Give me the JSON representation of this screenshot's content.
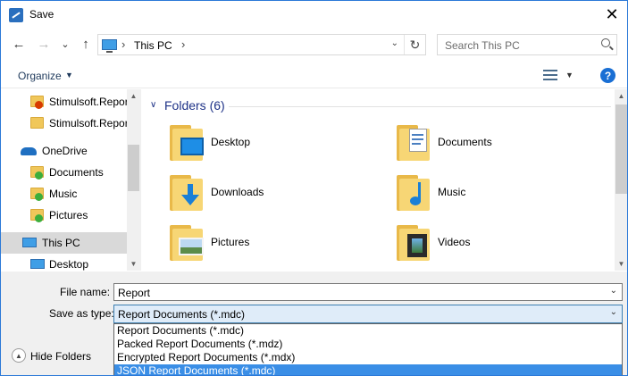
{
  "window": {
    "title": "Save",
    "close_glyph": "✕"
  },
  "nav": {
    "back_glyph": "←",
    "forward_glyph": "→",
    "recent_glyph": "⌄",
    "up_glyph": "↑",
    "address_separator": "›",
    "address_text": "This PC",
    "address_dropdown_glyph": "⌄",
    "refresh_glyph": "↻",
    "search_placeholder": "Search This PC"
  },
  "toolbar": {
    "organize_label": "Organize",
    "caret_glyph": "▼",
    "help_label": "?"
  },
  "sidebar": {
    "items": [
      {
        "label": "Stimulsoft.Repor",
        "icon": "folder-warning-icon"
      },
      {
        "label": "Stimulsoft.Repor",
        "icon": "folder-icon"
      },
      {
        "label": "OneDrive",
        "icon": "cloud-icon"
      },
      {
        "label": "Documents",
        "icon": "folder-synced-icon"
      },
      {
        "label": "Music",
        "icon": "folder-synced-icon"
      },
      {
        "label": "Pictures",
        "icon": "folder-synced-icon"
      },
      {
        "label": "This PC",
        "icon": "computer-icon",
        "selected": true
      },
      {
        "label": "Desktop",
        "icon": "desktop-icon"
      }
    ],
    "scroll_up_glyph": "▲",
    "scroll_down_glyph": "▼"
  },
  "content": {
    "group_header": "Folders (6)",
    "group_caret": "∨",
    "folders": [
      {
        "label": "Desktop",
        "icon": "desktop-folder-icon"
      },
      {
        "label": "Documents",
        "icon": "documents-folder-icon"
      },
      {
        "label": "Downloads",
        "icon": "downloads-folder-icon"
      },
      {
        "label": "Music",
        "icon": "music-folder-icon"
      },
      {
        "label": "Pictures",
        "icon": "pictures-folder-icon"
      },
      {
        "label": "Videos",
        "icon": "videos-folder-icon"
      }
    ]
  },
  "form": {
    "filename_label": "File name:",
    "filename_value": "Report",
    "savetype_label": "Save as type:",
    "savetype_value": "Report Documents (*.mdc)",
    "dropdown_glyph": "⌄",
    "type_options": [
      "Report Documents (*.mdc)",
      "Packed Report Documents (*.mdz)",
      "Encrypted Report Documents (*.mdx)",
      "JSON Report Documents (*.mdc)"
    ],
    "hide_folders_label": "Hide Folders",
    "hide_folders_glyph": "▲"
  }
}
